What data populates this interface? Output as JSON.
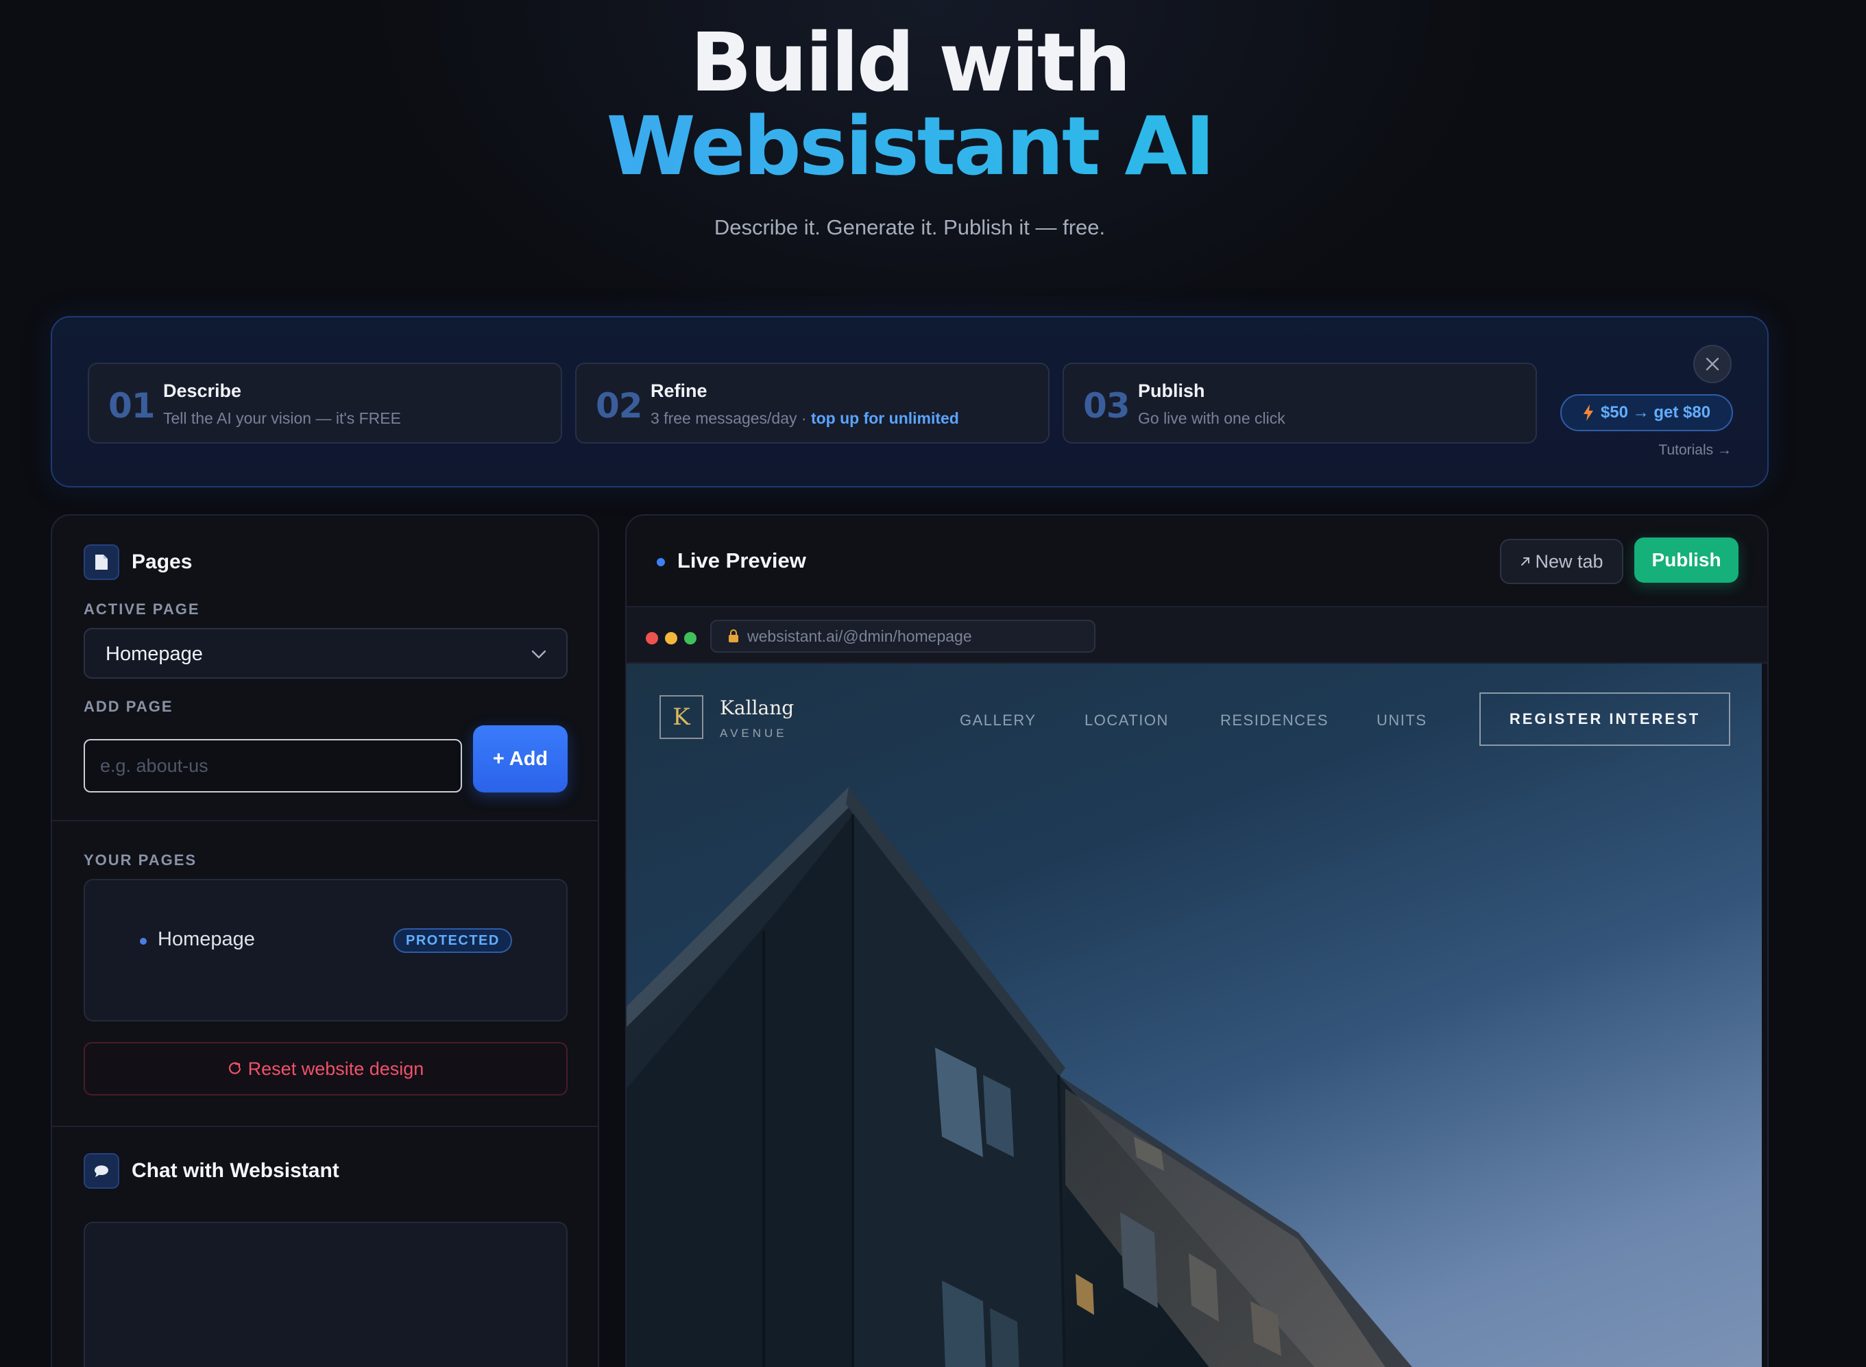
{
  "hero": {
    "title_line1": "Build with",
    "title_line2": "Websistant AI",
    "subtitle": "Describe it. Generate it. Publish it — free."
  },
  "steps": [
    {
      "num": "01",
      "title": "Describe",
      "desc": "Tell the AI your vision — it's FREE",
      "highlight": ""
    },
    {
      "num": "02",
      "title": "Refine",
      "desc": "3 free messages/day · ",
      "highlight": "top up for unlimited"
    },
    {
      "num": "03",
      "title": "Publish",
      "desc": "Go live with one click",
      "highlight": ""
    }
  ],
  "promo": {
    "label": "$50 → get $80",
    "tutorials": "Tutorials →"
  },
  "pages_panel": {
    "title": "Pages",
    "active_page_label": "ACTIVE PAGE",
    "active_page_value": "Homepage",
    "add_page_label": "ADD PAGE",
    "add_page_placeholder": "e.g. about-us",
    "add_button": "+ Add",
    "your_pages_label": "YOUR PAGES",
    "pages": [
      {
        "name": "Homepage",
        "badge": "PROTECTED"
      }
    ],
    "reset_button": "Reset website design"
  },
  "chat_panel": {
    "title": "Chat with Websistant"
  },
  "preview": {
    "title": "Live Preview",
    "new_tab": "New tab",
    "publish": "Publish",
    "url": "websistant.ai/@dmin/homepage",
    "site": {
      "logo_letter": "K",
      "brand_name": "Kallang",
      "brand_sub": "AVENUE",
      "nav": [
        "GALLERY",
        "LOCATION",
        "RESIDENCES",
        "UNITS"
      ],
      "cta": "REGISTER INTEREST"
    }
  },
  "colors": {
    "background": "#0b0d12",
    "accent_blue": "#3b82f6",
    "publish_green": "#16b07a",
    "reset_red": "#f0526a"
  }
}
